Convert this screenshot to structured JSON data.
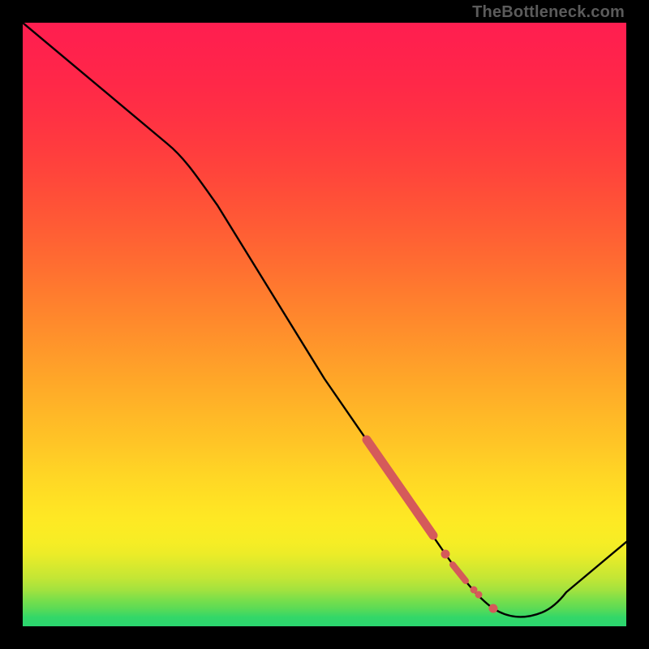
{
  "watermark": "TheBottleneck.com",
  "chart_data": {
    "type": "line",
    "title": "",
    "xlabel": "",
    "ylabel": "",
    "xlim": [
      0,
      100
    ],
    "ylim": [
      0,
      100
    ],
    "grid": false,
    "legend": false,
    "gradient_bands": [
      {
        "y": 0,
        "color": "#2ad56f"
      },
      {
        "y": 3,
        "color": "#5ddb55"
      },
      {
        "y": 6,
        "color": "#a2e23f"
      },
      {
        "y": 10,
        "color": "#d8e92e"
      },
      {
        "y": 14,
        "color": "#f6ed25"
      },
      {
        "y": 20,
        "color": "#ffe324"
      },
      {
        "y": 30,
        "color": "#ffc626"
      },
      {
        "y": 40,
        "color": "#ffa928"
      },
      {
        "y": 50,
        "color": "#ff8b2c"
      },
      {
        "y": 60,
        "color": "#ff6d31"
      },
      {
        "y": 70,
        "color": "#ff5237"
      },
      {
        "y": 80,
        "color": "#ff3a3f"
      },
      {
        "y": 90,
        "color": "#ff2848"
      },
      {
        "y": 100,
        "color": "#ff1e50"
      }
    ],
    "series": [
      {
        "name": "curve",
        "type": "line",
        "points": [
          {
            "x": 0,
            "y": 100
          },
          {
            "x": 24,
            "y": 80
          },
          {
            "x": 30,
            "y": 71
          },
          {
            "x": 50,
            "y": 41
          },
          {
            "x": 70,
            "y": 12
          },
          {
            "x": 78,
            "y": 3
          },
          {
            "x": 84,
            "y": 1.5
          },
          {
            "x": 90,
            "y": 2
          },
          {
            "x": 100,
            "y": 14
          }
        ]
      },
      {
        "name": "highlight-segment",
        "type": "line-thick",
        "color": "#d55a5a",
        "points": [
          {
            "x": 57,
            "y": 31
          },
          {
            "x": 68,
            "y": 15
          }
        ]
      },
      {
        "name": "highlight-dots",
        "type": "scatter",
        "color": "#d55a5a",
        "points": [
          {
            "x": 70,
            "y": 12
          },
          {
            "x": 72,
            "y": 9
          },
          {
            "x": 73.5,
            "y": 8
          },
          {
            "x": 75.5,
            "y": 6
          },
          {
            "x": 78,
            "y": 3
          }
        ]
      }
    ]
  }
}
